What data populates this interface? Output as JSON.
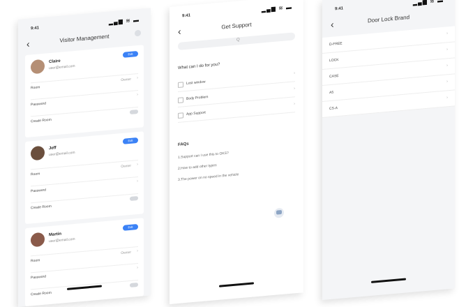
{
  "status": {
    "time": "9:41",
    "signal": "▂▄▆ ≋ ▬"
  },
  "icons": [
    "chevron-left-icon",
    "gear-icon",
    "search-icon",
    "chevron-right-icon",
    "chat-icon"
  ],
  "screen1": {
    "title": "Visitor Management",
    "users": [
      {
        "name": "Claire",
        "email": "user@email.com",
        "action": "Edit",
        "rows": [
          {
            "label": "Room",
            "value": "Owner"
          },
          {
            "label": "Password",
            "value": ""
          },
          {
            "label": "Create Room",
            "value": ""
          }
        ]
      },
      {
        "name": "Jeff",
        "email": "user@email.com",
        "action": "Edit",
        "rows": [
          {
            "label": "Room",
            "value": "Owner"
          },
          {
            "label": "Password",
            "value": ""
          },
          {
            "label": "Create Room",
            "value": ""
          }
        ]
      },
      {
        "name": "Martin",
        "email": "user@email.com",
        "action": "Edit",
        "rows": [
          {
            "label": "Room",
            "value": "Owner"
          },
          {
            "label": "Password",
            "value": ""
          },
          {
            "label": "Create Room",
            "value": ""
          }
        ]
      }
    ]
  },
  "screen2": {
    "title": "Get Support",
    "search_placeholder": "Q",
    "question": "What can I do for you?",
    "options": [
      "Lost window",
      "Body Problem",
      "App Support"
    ],
    "faq_title": "FAQs",
    "faqs": [
      "1.Support can I use this to OKS?",
      "2.How to add other types",
      "3.The power on no speed in the vehicle"
    ]
  },
  "screen3": {
    "title": "Door Lock Brand",
    "brands": [
      "D-FREE",
      "LOCK",
      "CASE",
      "A5",
      "CS-A"
    ]
  }
}
